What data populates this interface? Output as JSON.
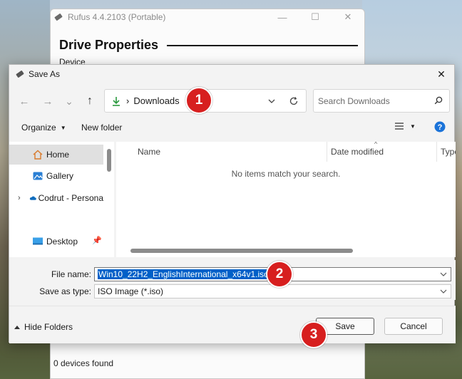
{
  "rufus": {
    "title": "Rufus 4.4.2103 (Portable)",
    "heading": "Drive Properties",
    "device_label": "Device",
    "status": "0 devices found",
    "controls": [
      "—",
      "☐",
      "✕"
    ]
  },
  "dialog": {
    "title": "Save As",
    "close_glyph": "✕",
    "nav": {
      "back_glyph": "←",
      "forward_glyph": "→",
      "recent_glyph": "⌄",
      "up_glyph": "↑",
      "address_crumb_sep": "›",
      "address_location": "Downloads",
      "search_placeholder": "Search Downloads"
    },
    "toolbar": {
      "organize": "Organize",
      "new_folder": "New folder"
    },
    "nav_pane": {
      "items": [
        {
          "label": "Home",
          "icon": "home-icon"
        },
        {
          "label": "Gallery",
          "icon": "gallery-icon"
        },
        {
          "label": "Codrut - Persona",
          "icon": "onedrive-icon"
        },
        {
          "label": "Desktop",
          "icon": "desktop-icon"
        }
      ]
    },
    "columns": [
      "Name",
      "Date modified",
      "Type"
    ],
    "empty_message": "No items match your search.",
    "file_name_label": "File name:",
    "file_name_value": "Win10_22H2_EnglishInternational_x64v1.iso",
    "save_type_label": "Save as type:",
    "save_type_value": "ISO Image (*.iso)",
    "hide_folders": "Hide Folders",
    "save_button": "Save",
    "cancel_button": "Cancel"
  },
  "annotations": [
    "1",
    "2",
    "3"
  ],
  "colors": {
    "accent": "#0060c8",
    "badge": "#d71f1f",
    "download_arrow": "#2b9a3f",
    "help": "#1a73d9"
  }
}
